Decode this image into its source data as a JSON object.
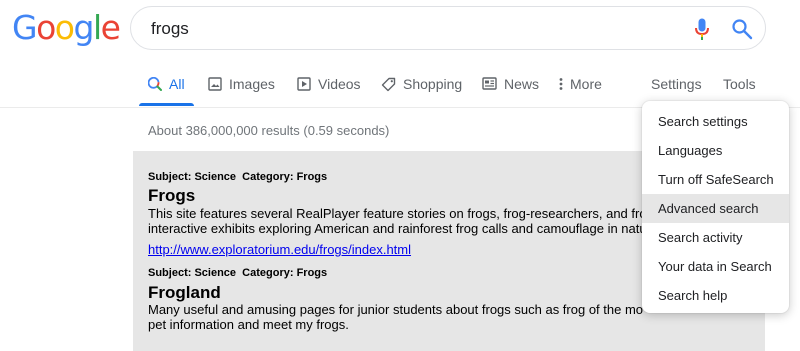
{
  "logo": {
    "letters": [
      {
        "ch": "G",
        "color": "#4285F4"
      },
      {
        "ch": "o",
        "color": "#EA4335"
      },
      {
        "ch": "o",
        "color": "#FBBC05"
      },
      {
        "ch": "g",
        "color": "#4285F4"
      },
      {
        "ch": "l",
        "color": "#34A853"
      },
      {
        "ch": "e",
        "color": "#EA4335"
      }
    ]
  },
  "search": {
    "query": "frogs"
  },
  "tabs": {
    "all": "All",
    "images": "Images",
    "videos": "Videos",
    "shopping": "Shopping",
    "news": "News",
    "more": "More",
    "settings": "Settings",
    "tools": "Tools"
  },
  "stats": "About 386,000,000 results (0.59 seconds)",
  "results": [
    {
      "subject_label": "Subject: Science",
      "category_label": "Category: Frogs",
      "title": "Frogs",
      "desc_line1": "This site features several RealPlayer feature stories on frogs, frog-researchers, and fro",
      "desc_line2": "interactive exhibits exploring American and rainforest frog calls and camouflage in natu",
      "url": "http://www.exploratorium.edu/frogs/index.html"
    },
    {
      "subject_label": "Subject: Science",
      "category_label": "Category: Frogs",
      "title": "Frogland",
      "desc_line1": "Many useful and amusing pages for junior students about frogs such as frog of the mo",
      "desc_line2": "pet information and meet my frogs."
    }
  ],
  "settings_menu": {
    "items": [
      "Search settings",
      "Languages",
      "Turn off SafeSearch",
      "Advanced search",
      "Search activity",
      "Your data in Search",
      "Search help"
    ],
    "highlighted": "Advanced search"
  },
  "colors": {
    "accent": "#1a73e8",
    "link": "#0000ee",
    "result_bg": "#e6e6e6"
  }
}
